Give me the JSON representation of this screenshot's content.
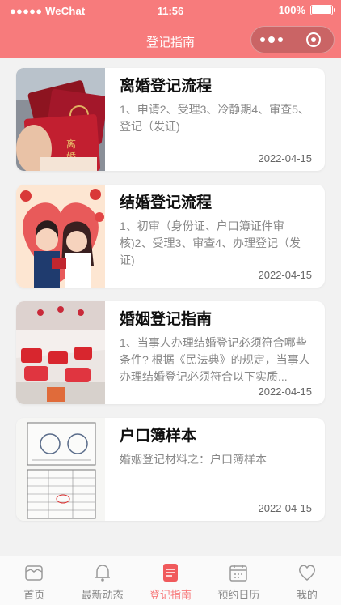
{
  "status_bar": {
    "carrier": "●●●●● WeChat",
    "time": "11:56",
    "battery": "100%"
  },
  "navbar": {
    "title": "登记指南"
  },
  "cards": [
    {
      "title": "离婚登记流程",
      "desc": "1、申请2、受理3、冷静期4、审查5、登记（发证)",
      "date": "2022-04-15",
      "image": "divorce-certificates-photo"
    },
    {
      "title": "结婚登记流程",
      "desc": "1、初审（身份证、户口簿证件审核)2、受理3、审查4、办理登记（发证)",
      "date": "2022-04-15",
      "image": "couple-illustration"
    },
    {
      "title": "婚姻登记指南",
      "desc": "1、当事人办理结婚登记必须符合哪些条件? 根据《民法典》的规定，当事人办理结婚登记必须符合以下实质...",
      "date": "2022-04-15",
      "image": "registration-hall-photo"
    },
    {
      "title": "户口簿样本",
      "desc": "婚姻登记材料之：户口簿样本",
      "date": "2022-04-15",
      "image": "household-register-sample"
    }
  ],
  "tabbar": [
    {
      "label": "首页",
      "icon": "home-icon",
      "active": false
    },
    {
      "label": "最新动态",
      "icon": "bell-icon",
      "active": false
    },
    {
      "label": "登记指南",
      "icon": "guide-book-icon",
      "active": true
    },
    {
      "label": "预约日历",
      "icon": "calendar-icon",
      "active": false
    },
    {
      "label": "我的",
      "icon": "heart-icon",
      "active": false
    }
  ],
  "colors": {
    "primary": "#f77b7c",
    "background": "#f2f2f2",
    "text_muted": "#888888"
  }
}
